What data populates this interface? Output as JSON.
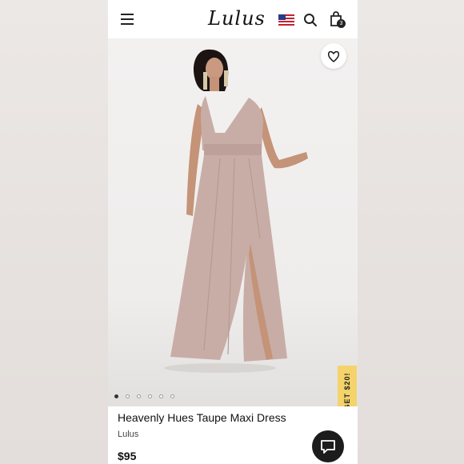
{
  "header": {
    "logo_text": "Lulus",
    "cart_count": "3"
  },
  "gallery": {
    "image_count": 6,
    "active_index": 0,
    "promo_tab": "GET $20!"
  },
  "product": {
    "title": "Heavenly Hues Taupe Maxi Dress",
    "brand": "Lulus",
    "price": "$95"
  },
  "colors": {
    "dress": "#c8ada6",
    "promo": "#f4d36b",
    "chat_button": "#1c1c1c"
  }
}
